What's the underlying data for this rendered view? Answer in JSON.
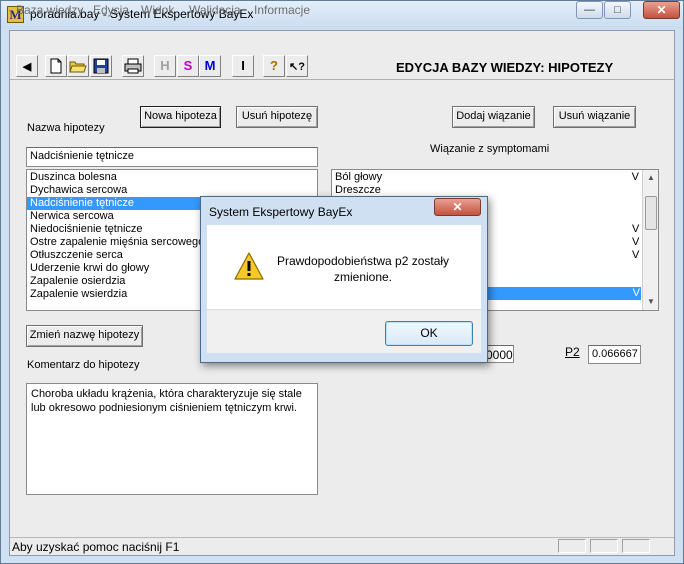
{
  "window": {
    "title": "poradnia.bay - System Ekspertowy BayEx",
    "app_icon_letter": "M",
    "minimize": "—",
    "maximize": "□",
    "close": "✕"
  },
  "menu": [
    "Baza wiedzy",
    "Edycja",
    "Widok",
    "Walidacja",
    "Informacje"
  ],
  "toolbar": {
    "buttons": [
      "back-arrow-icon",
      "new-file-icon",
      "open-folder-icon",
      "save-disk-icon",
      "print-icon",
      "H",
      "S",
      "M",
      "I",
      "help-icon",
      "context-help-icon"
    ],
    "h_label": "H",
    "s_label": "S",
    "m_label": "M",
    "i_label": "I",
    "back_glyph": "◀",
    "help_glyph": "?",
    "ctxhelp_glyph": "↖?",
    "screen_title": "EDYCJA BAZY WIEDZY: HIPOTEZY"
  },
  "form": {
    "new_hypothesis_btn": "Nowa hipoteza",
    "delete_hypothesis_btn": "Usuń hipotezę",
    "add_binding_btn": "Dodaj wiązanie",
    "delete_binding_btn": "Usuń wiązanie",
    "hypothesis_name_label": "Nazwa hipotezy",
    "hypothesis_name_value": "Nadciśnienie tętnicze",
    "symptom_binding_label": "Wiązanie z symptomami",
    "hypotheses": [
      "Duszinca bolesna",
      "Dychawica sercowa",
      "Nadciśnienie tętnicze",
      "Nerwica sercowa",
      "Niedociśnienie tętnicze",
      "Ostre zapalenie mięśnia sercowego",
      "Otłuszczenie serca",
      "Uderzenie krwi do głowy",
      "Zapalenie osierdzia",
      "Zapalenie wsierdzia"
    ],
    "selected_hypothesis_index": 2,
    "symptoms": [
      {
        "name": "Ból głowy",
        "mark": "V"
      },
      {
        "name": "Dreszcze",
        "mark": ""
      }
    ],
    "symptom_marks_right": [
      "V",
      "V",
      "V"
    ],
    "symptom_selected_mark": "V",
    "rename_btn": "Zmień nazwę hipotezy",
    "comment_label": "Komentarz do hipotezy",
    "comment_text": "Choroba układu krążenia, która charakteryzuje się stale lub okresowo podniesionym ciśnieniem tętniczym krwi.",
    "p1_partial_value": "0000",
    "p2_label": "P2",
    "p2_value": "0.066667"
  },
  "status": {
    "text": "Aby uzyskać pomoc naciśnij F1"
  },
  "dialog": {
    "title": "System Ekspertowy BayEx",
    "close": "✕",
    "message": "Prawdopodobieństwa p2 zostały zmienione.",
    "icon": "warning-icon",
    "ok_label": "OK"
  },
  "colors": {
    "selection": "#3399ff",
    "accent_s": "#c000c0",
    "accent_m": "#0000d0"
  }
}
